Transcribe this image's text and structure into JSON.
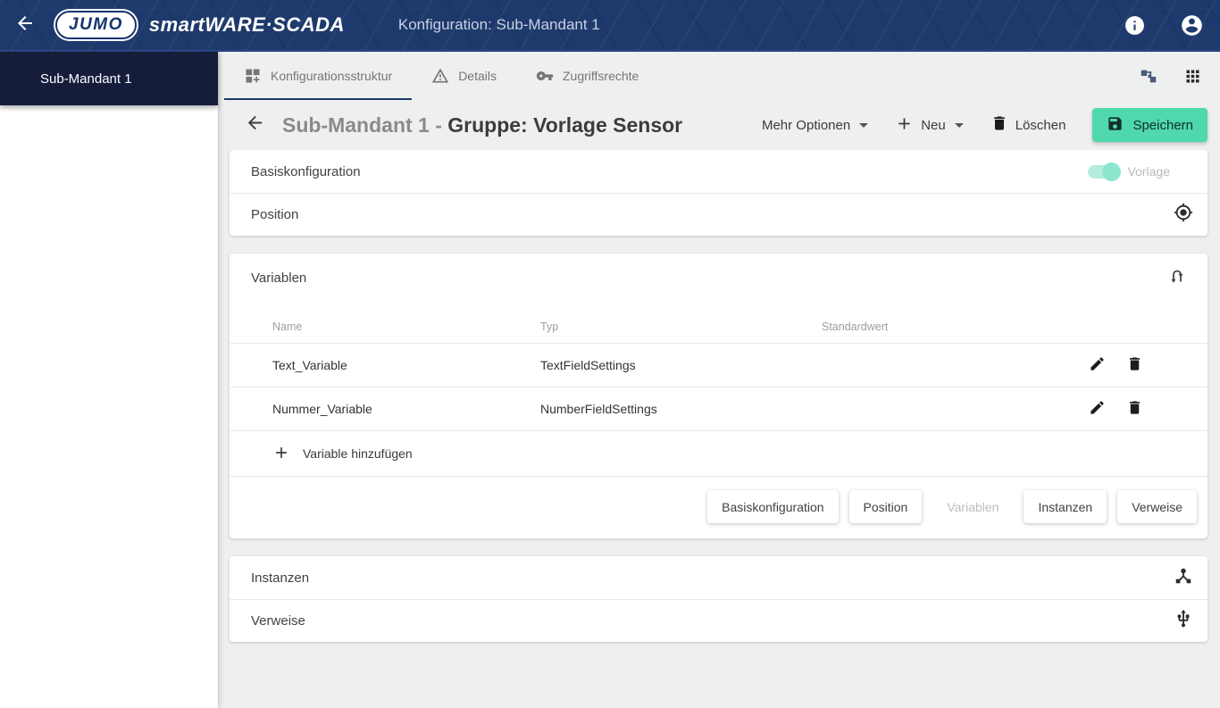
{
  "topbar": {
    "logo_text": "JUMO",
    "brand": "smartWARE·SCADA",
    "title": "Konfiguration: Sub-Mandant 1",
    "icons": {
      "back": "arrow-left",
      "info": "info-circle",
      "account": "account-circle"
    }
  },
  "sidebar": {
    "item": "Sub-Mandant 1"
  },
  "tabs": [
    {
      "label": "Konfigurationsstruktur",
      "icon": "dashboard-customize",
      "active": true
    },
    {
      "label": "Details",
      "icon": "warning-triangle",
      "active": false
    },
    {
      "label": "Zugriffsrechte",
      "icon": "key",
      "active": false
    }
  ],
  "tabbar_right_icons": [
    "schema-tree",
    "apps-grid"
  ],
  "header": {
    "title_prefix": "Sub-Mandant 1 - ",
    "title_main": "Gruppe: Vorlage Sensor",
    "more_options_label": "Mehr Optionen",
    "new_label": "Neu",
    "delete_label": "Löschen",
    "save_label": "Speichern"
  },
  "sections": {
    "basiskonfiguration": {
      "label": "Basiskonfiguration",
      "toggle_label": "Vorlage",
      "toggle_on": true
    },
    "position": {
      "label": "Position",
      "icon": "my-location"
    },
    "variablen": {
      "label": "Variablen",
      "icon": "swap-reorder",
      "columns": {
        "name": "Name",
        "typ": "Typ",
        "standardwert": "Standardwert"
      },
      "rows": [
        {
          "name": "Text_Variable",
          "typ": "TextFieldSettings",
          "standardwert": ""
        },
        {
          "name": "Nummer_Variable",
          "typ": "NumberFieldSettings",
          "standardwert": ""
        }
      ],
      "add_label": "Variable hinzufügen",
      "footer_buttons": [
        {
          "label": "Basiskonfiguration",
          "disabled": false
        },
        {
          "label": "Position",
          "disabled": false
        },
        {
          "label": "Variablen",
          "disabled": true
        },
        {
          "label": "Instanzen",
          "disabled": false
        },
        {
          "label": "Verweise",
          "disabled": false
        }
      ]
    },
    "instanzen": {
      "label": "Instanzen",
      "icon": "device-hub"
    },
    "verweise": {
      "label": "Verweise",
      "icon": "usb"
    }
  },
  "colors": {
    "topbar_navy": "#1e3a6c",
    "sidebar_header_navy": "#151d3b",
    "accent_green": "#4fd7ad",
    "tab_underline": "#1c3667",
    "toggle_mint": "#8ce7ce"
  }
}
